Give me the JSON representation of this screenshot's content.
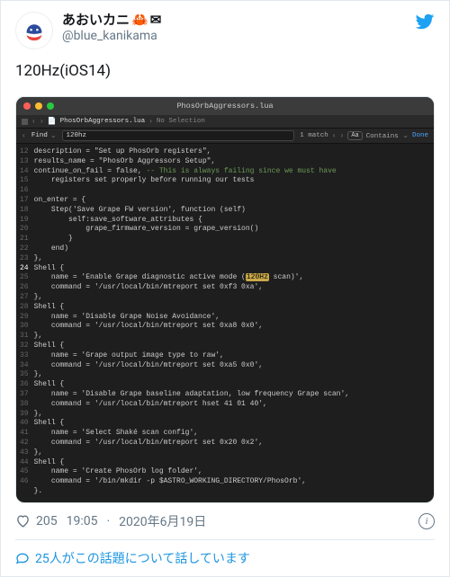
{
  "tweet": {
    "display_name": "あおいカニ",
    "emoji_crab": "🦀",
    "emoji_envelope": "✉",
    "handle": "@blue_kanikama",
    "body": "120Hz(iOS14)",
    "likes": "205",
    "time": "19:05",
    "sep": " · ",
    "date": "2020年6月19日",
    "convo": "25人がこの話題について話しています"
  },
  "editor": {
    "title": "PhosOrbAggressors.lua",
    "tab_file": "PhosOrbAggressors.lua",
    "tab_nosel": "No Selection",
    "find_label": "Find",
    "find_value": "120hz",
    "match_count": "1 match",
    "aa": "Aa",
    "contains": "Contains",
    "done": "Done",
    "code": {
      "desc": "description = \"Set up PhosOrb registers\",",
      "results": "results_name = \"PhosOrb Aggressors Setup\",",
      "cof1": "continue_on_fail = false, ",
      "cof_cm": "-- This is always failing since we must have",
      "cof2": "    registers set properly before running our tests",
      "onenter": "on_enter = {",
      "step": "    Step('Save Grape FW version', function (self)",
      "selfsave": "        self:save_software_attributes {",
      "grapefw": "            grape_firmware_version = grape_version()",
      "brace_close_inner": "        }",
      "end_paren": "    end)",
      "close_oe": "},",
      "shell": "Shell {",
      "s1_name_a": "    name = 'Enable Grape diagnostic active mode (",
      "s1_hl": "120Hz",
      "s1_name_b": " scan)',",
      "s1_cmd": "    command = '/usr/local/bin/mtreport set 0xf3 0xa',",
      "shell_close": "},",
      "s2_name": "    name = 'Disable Grape Noise Avoidance',",
      "s2_cmd": "    command = '/usr/local/bin/mtreport set 0xa8 0x0',",
      "s3_name": "    name = 'Grape output image type to raw',",
      "s3_cmd": "    command = '/usr/local/bin/mtreport set 0xa5 0x0',",
      "s4_name": "    name = 'Disable Grape baseline adaptation, low frequency Grape scan',",
      "s4_cmd": "    command = '/usr/local/bin/mtreport hset 41 01 40',",
      "s5_name": "    name = 'Select Shaké scan config',",
      "s5_cmd": "    command = '/usr/local/bin/mtreport set 0x20 0x2',",
      "s6_name": "    name = 'Create PhosOrb log folder',",
      "s6_cmd": "    command = '/bin/mkdir -p $ASTRO_WORKING_DIRECTORY/PhosOrb',",
      "trailing": "}."
    },
    "lines": [
      "12",
      "13",
      "14",
      "15",
      "16",
      "17",
      "18",
      "19",
      "20",
      "21",
      "22",
      "23",
      "24",
      "25",
      "26",
      "27",
      "28",
      "29",
      "30",
      "31",
      "32",
      "33",
      "34",
      "35",
      "36",
      "37",
      "38",
      "39",
      "40",
      "41",
      "42",
      "43",
      "44",
      "45",
      "46"
    ]
  }
}
